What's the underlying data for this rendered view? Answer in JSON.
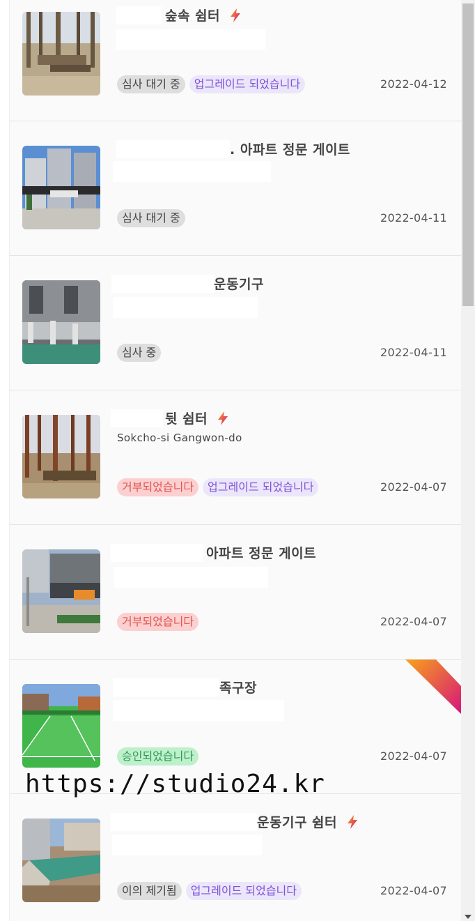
{
  "items": [
    {
      "title": "숲속 쉼터",
      "address": "",
      "boosted": true,
      "badges": [
        {
          "label": "심사 대기 중",
          "style": "gray"
        },
        {
          "label": "업그레이드 되었습니다",
          "style": "purple"
        }
      ],
      "date": "2022-04-12"
    },
    {
      "title": ". 아파트 정문 게이트",
      "address": "",
      "boosted": false,
      "badges": [
        {
          "label": "심사 대기 중",
          "style": "gray"
        }
      ],
      "date": "2022-04-11"
    },
    {
      "title": "운동기구",
      "address": "",
      "boosted": false,
      "badges": [
        {
          "label": "심사 중",
          "style": "gray"
        }
      ],
      "date": "2022-04-11"
    },
    {
      "title": "뒷 쉼터",
      "address": "Sokcho-si Gangwon-do",
      "boosted": true,
      "badges": [
        {
          "label": "거부되었습니다",
          "style": "red"
        },
        {
          "label": "업그레이드 되었습니다",
          "style": "purple"
        }
      ],
      "date": "2022-04-07"
    },
    {
      "title": "아파트 정문 게이트",
      "address": "",
      "boosted": false,
      "badges": [
        {
          "label": "거부되었습니다",
          "style": "red"
        }
      ],
      "date": "2022-04-07"
    },
    {
      "title": "족구장",
      "address": "",
      "boosted": false,
      "corner_ribbon": true,
      "badges": [
        {
          "label": "승인되었습니다",
          "style": "green"
        }
      ],
      "date": "2022-04-07"
    },
    {
      "title": "운동기구 쉼터",
      "address": "",
      "boosted": true,
      "badges": [
        {
          "label": "이의 제기됨",
          "style": "gray"
        },
        {
          "label": "업그레이드 되었습니다",
          "style": "purple"
        }
      ],
      "date": "2022-04-07"
    }
  ],
  "watermark": "https://studio24.kr",
  "icons": {
    "boost": "lightning-bolt-icon",
    "scroll_down": "scroll-down-arrow-icon"
  },
  "colors": {
    "badge_gray": "#dedede",
    "badge_purple": "#ece6fb",
    "badge_red": "#fcd0d0",
    "badge_green": "#bff0cc",
    "ribbon_start": "#f7a21b",
    "ribbon_end": "#d6157a"
  }
}
